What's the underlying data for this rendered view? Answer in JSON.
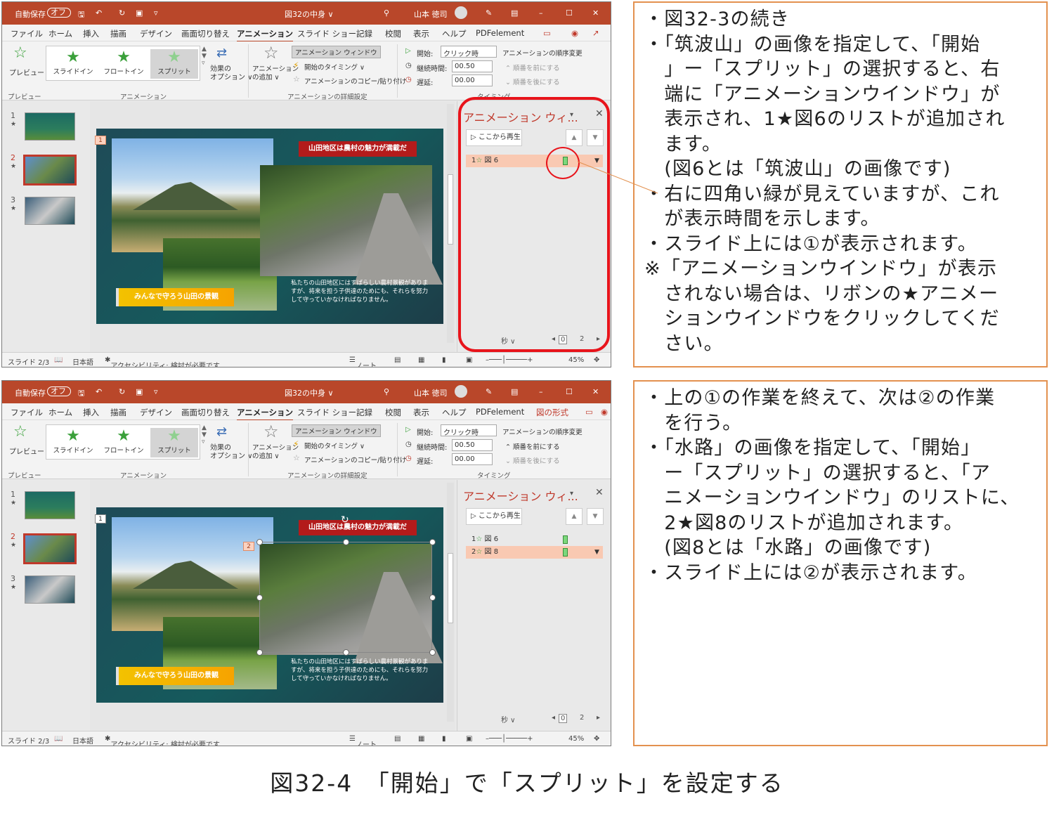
{
  "screens": [
    {
      "title": {
        "autosave": "自動保存",
        "toggle": "オフ",
        "doc": "図32の中身 ∨",
        "user": "山本 徳司"
      },
      "menu": [
        "ファイル",
        "ホーム",
        "挿入",
        "描画",
        "デザイン",
        "画面切り替え",
        "アニメーション",
        "スライド ショー",
        "記録",
        "校閲",
        "表示",
        "ヘルプ",
        "PDFelement"
      ],
      "menu_extra": "",
      "ribbon": {
        "preview": "プレビュー",
        "gallery": [
          "スライドイン",
          "フロートイン",
          "スプリット"
        ],
        "effect": "効果の\nオプション ∨",
        "add": "アニメーション\nの追加 ∨",
        "pane": "アニメーション ウィンドウ",
        "timing": "開始のタイミング ∨",
        "copy": "アニメーションのコピー/貼り付け",
        "start_l": "開始:",
        "start_v": "クリック時",
        "dur_l": "継続時間:",
        "dur_v": "00.50",
        "delay_l": "遅延:",
        "delay_v": "00.00",
        "order": "アニメーションの順序変更",
        "fwd": "順番を前にする",
        "back": "順番を後にする",
        "grp_preview": "プレビュー",
        "grp_anim": "アニメーション",
        "grp_detail": "アニメーションの詳細設定",
        "grp_timing": "タイミング"
      },
      "thumb_nums": [
        "1",
        "2",
        "3"
      ],
      "slide": {
        "banner_red": "山田地区は農村の魅力が満載だ",
        "banner_yellow": "みんなで守ろう山田の景観",
        "text": "私たちの山田地区にはすばらしい農村景観がありますが、将来を担う子供達のためにも、それらを努力して守っていかなければなりません。",
        "marker1": "1",
        "marker2": ""
      },
      "pane": {
        "title": "アニメーション ウィ...",
        "play": "ここから再生",
        "rows": [
          {
            "num": "1",
            "label": "図 6"
          }
        ],
        "sec": "秒 ∨",
        "pg0": "0",
        "pg2": "2"
      },
      "status": {
        "slide": "スライド 2/3",
        "lang": "日本語",
        "access": "アクセシビリティ: 検討が必要です",
        "note": "ノート",
        "zoom": "45%"
      }
    },
    {
      "title": {
        "autosave": "自動保存",
        "toggle": "オフ",
        "doc": "図32の中身 ∨",
        "user": "山本 徳司"
      },
      "menu": [
        "ファイル",
        "ホーム",
        "挿入",
        "描画",
        "デザイン",
        "画面切り替え",
        "アニメーション",
        "スライド ショー",
        "記録",
        "校閲",
        "表示",
        "ヘルプ",
        "PDFelement"
      ],
      "menu_extra": "図の形式",
      "ribbon": {
        "preview": "プレビュー",
        "gallery": [
          "スライドイン",
          "フロートイン",
          "スプリット"
        ],
        "effect": "効果の\nオプション ∨",
        "add": "アニメーション\nの追加 ∨",
        "pane": "アニメーション ウィンドウ",
        "timing": "開始のタイミング ∨",
        "copy": "アニメーションのコピー/貼り付け",
        "start_l": "開始:",
        "start_v": "クリック時",
        "dur_l": "継続時間:",
        "dur_v": "00.50",
        "delay_l": "遅延:",
        "delay_v": "00.00",
        "order": "アニメーションの順序変更",
        "fwd": "順番を前にする",
        "back": "順番を後にする",
        "grp_preview": "プレビュー",
        "grp_anim": "アニメーション",
        "grp_detail": "アニメーションの詳細設定",
        "grp_timing": "タイミング"
      },
      "thumb_nums": [
        "1",
        "2",
        "3"
      ],
      "slide": {
        "banner_red": "山田地区は農村の魅力が満載だ",
        "banner_yellow": "みんなで守ろう山田の景観",
        "text": "私たちの山田地区にはすばらしい農村景観がありますが、将来を担う子供達のためにも、それらを努力して守っていかなければなりません。",
        "marker1": "1",
        "marker2": "2"
      },
      "pane": {
        "title": "アニメーション ウィ...",
        "play": "ここから再生",
        "rows": [
          {
            "num": "1",
            "label": "図 6"
          },
          {
            "num": "2",
            "label": "図 8"
          }
        ],
        "sec": "秒 ∨",
        "pg0": "0",
        "pg2": "2"
      },
      "status": {
        "slide": "スライド 2/3",
        "lang": "日本語",
        "access": "アクセシビリティ: 検討が必要です",
        "note": "ノート",
        "zoom": "45%"
      }
    }
  ],
  "notes": [
    [
      "・図32-3の続き",
      "・「筑波山」の画像を指定して、「開始",
      "　」ー「スプリット」の選択すると、右",
      "　端に「アニメーションウインドウ」が",
      "　表示され、1★図6のリストが追加され",
      "　ます。",
      "　(図6とは「筑波山」の画像です)",
      "・右に四角い緑が見えていますが、これ",
      "　が表示時間を示します。",
      "・スライド上には①が表示されます。",
      "※「アニメーションウインドウ」が表示",
      "　されない場合は、リボンの★アニメー",
      "　ションウインドウをクリックしてくだ",
      "　さい。"
    ],
    [
      "・上の①の作業を終えて、次は②の作業",
      "　を行う。",
      "・「水路」の画像を指定して、「開始」",
      "　ー「スプリット」の選択すると、「ア",
      "　ニメーションウインドウ」のリストに、",
      "　2★図8のリストが追加されます。",
      "　(図8とは「水路」の画像です)",
      "・スライド上には②が表示されます。"
    ]
  ],
  "caption": "図32-4　「開始」で「スプリット」を設定する",
  "colors": {
    "titlebar": "#b9472a",
    "highlight": "#e8141b",
    "note_border": "#e3914f"
  }
}
